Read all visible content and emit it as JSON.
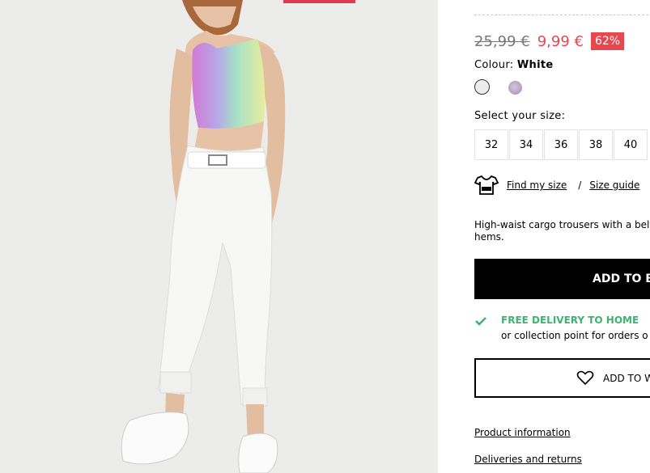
{
  "product": {
    "old_price": "25,99 €",
    "new_price": "9,99 €",
    "discount": "62%",
    "colour_label": "Colour:",
    "colour_value": "White",
    "swatches": [
      "white-swatch",
      "lilac-swatch"
    ],
    "size_label": "Select your size:",
    "sizes": [
      "32",
      "34",
      "36",
      "38",
      "40"
    ],
    "find_my_size": "Find my size",
    "separator": "/",
    "size_guide": "Size guide",
    "description": "High-waist cargo trousers with a belt. turn-up hems.",
    "add_to_bag": "ADD TO BA",
    "delivery_title": "FREE DELIVERY TO HOME",
    "delivery_sub": "or collection point for orders o",
    "wishlist": "ADD TO W",
    "links": [
      "Product information",
      "Deliveries and returns"
    ]
  },
  "colors": {
    "accent": "#e8474f",
    "delivery_green": "#3cb371",
    "button_black": "#000000"
  }
}
